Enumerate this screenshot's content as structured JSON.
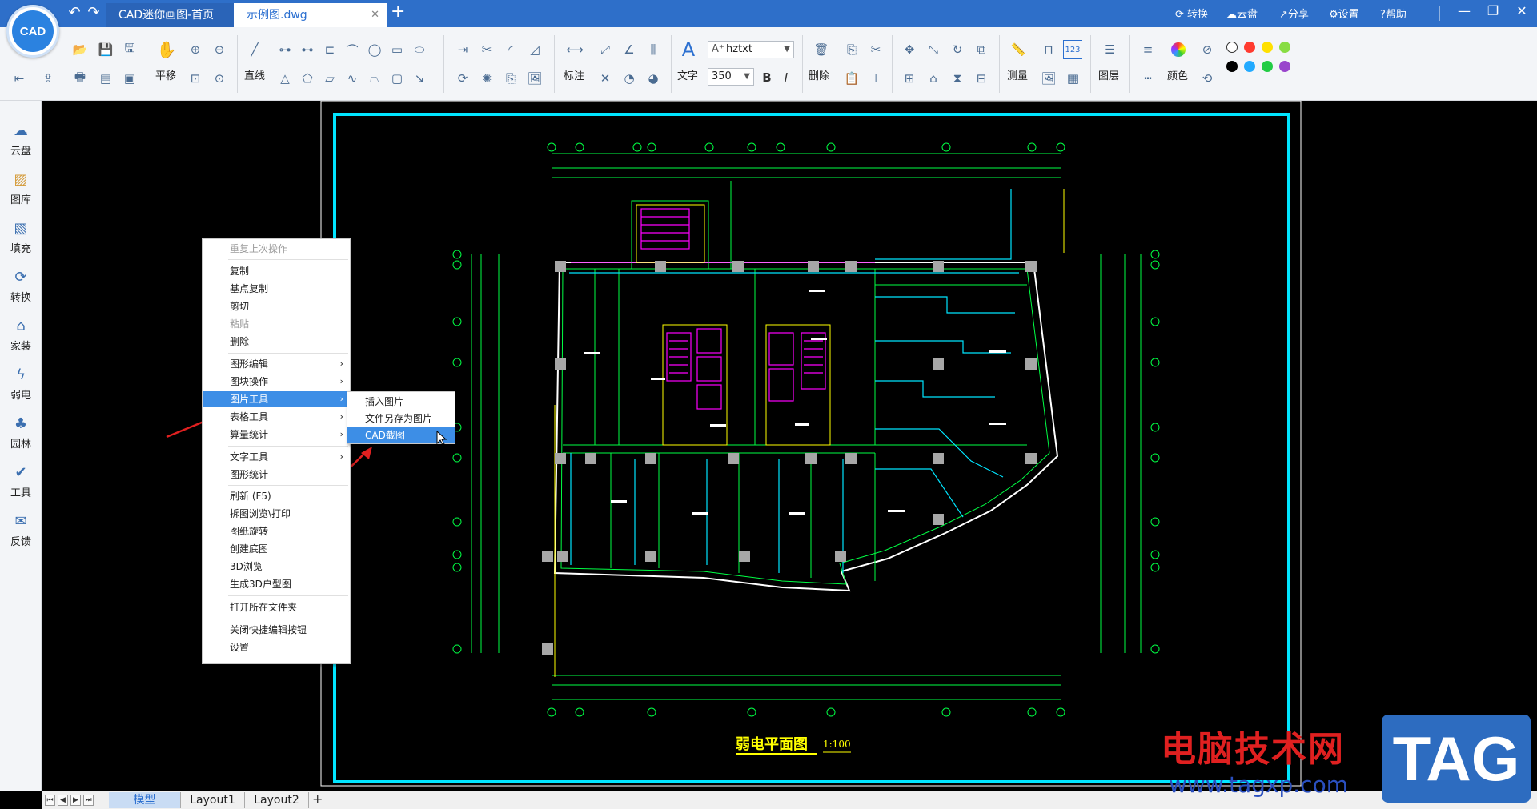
{
  "title_bar": {
    "tabs": [
      {
        "label": "CAD迷你画图-首页"
      },
      {
        "label": "示例图.dwg"
      }
    ],
    "right_items": [
      "转换",
      "云盘",
      "分享",
      "设置",
      "帮助"
    ]
  },
  "ribbon": {
    "labels": {
      "pan": "平移",
      "line": "直线",
      "dimension": "标注",
      "text": "文字",
      "delete": "删除",
      "measure": "测量",
      "layer": "图层",
      "color": "颜色"
    },
    "font_combo": "hztxt",
    "size_combo": "350",
    "bold": "B",
    "italic": "I",
    "text_icon": "A",
    "num_icon": "123",
    "colors": [
      "#ffffff",
      "#ff3b30",
      "#ffe000",
      "#88dd44",
      "#000000",
      "#22aaff",
      "#22cc44",
      "#9944cc"
    ]
  },
  "sidebar": {
    "items": [
      {
        "label": "云盘",
        "icon": "cloud-icon"
      },
      {
        "label": "图库",
        "icon": "gallery-icon"
      },
      {
        "label": "填充",
        "icon": "fill-icon"
      },
      {
        "label": "转换",
        "icon": "convert-icon"
      },
      {
        "label": "家装",
        "icon": "home-icon"
      },
      {
        "label": "弱电",
        "icon": "lightning-icon"
      },
      {
        "label": "园林",
        "icon": "tree-icon"
      },
      {
        "label": "工具",
        "icon": "tools-icon"
      },
      {
        "label": "反馈",
        "icon": "mail-icon"
      }
    ]
  },
  "context_menu": {
    "items": [
      {
        "label": "重复上次操作"
      },
      {
        "label": "复制"
      },
      {
        "label": "基点复制"
      },
      {
        "label": "剪切"
      },
      {
        "label": "粘贴"
      },
      {
        "label": "删除"
      },
      {
        "label": "图形编辑"
      },
      {
        "label": "图块操作"
      },
      {
        "label": "图片工具"
      },
      {
        "label": "表格工具"
      },
      {
        "label": "算量统计"
      },
      {
        "label": "文字工具"
      },
      {
        "label": "图形统计"
      },
      {
        "label": "刷新 (F5)"
      },
      {
        "label": "拆图浏览\\打印"
      },
      {
        "label": "图纸旋转"
      },
      {
        "label": "创建底图"
      },
      {
        "label": "3D浏览"
      },
      {
        "label": "生成3D户型图"
      },
      {
        "label": "打开所在文件夹"
      },
      {
        "label": "关闭快捷编辑按钮"
      },
      {
        "label": "设置"
      }
    ],
    "submenu_arrow": "›",
    "submenu": [
      {
        "label": "插入图片"
      },
      {
        "label": "文件另存为图片"
      },
      {
        "label": "CAD截图"
      }
    ]
  },
  "drawing": {
    "title": "弱电平面图",
    "scale": "1:100"
  },
  "layout_tabs": [
    "模型",
    "Layout1",
    "Layout2"
  ],
  "watermark": {
    "text": "电脑技术网",
    "url": "www.tagxp.com",
    "tag": "TAG"
  }
}
